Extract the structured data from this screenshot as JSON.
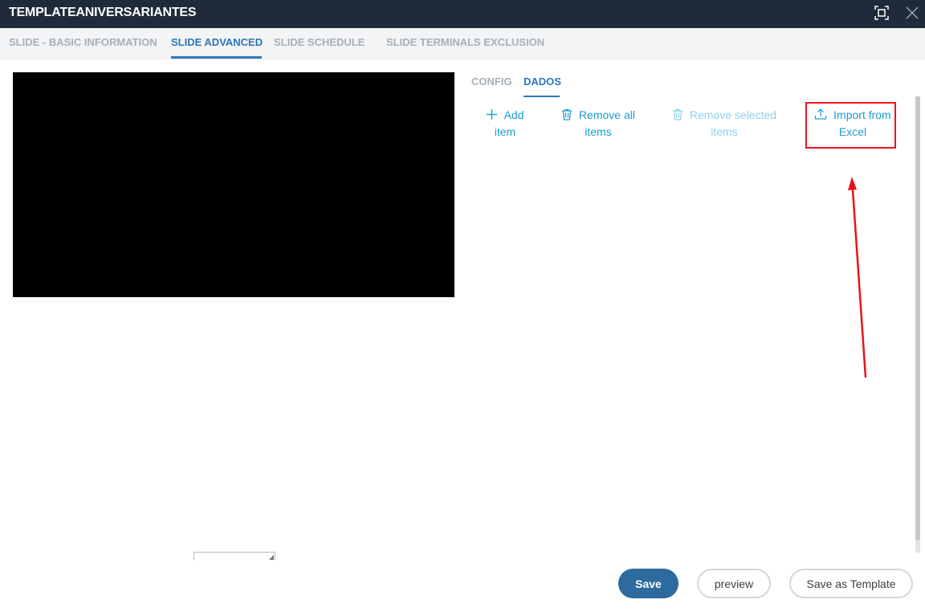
{
  "window": {
    "title": "TEMPLATEANIVERSARIANTES",
    "maximize_icon": "maximize-icon",
    "close_icon": "close-icon"
  },
  "tabs": [
    {
      "label": "SLIDE - BASIC INFORMATION",
      "active": false
    },
    {
      "label": "SLIDE ADVANCED",
      "active": true
    },
    {
      "label": "SLIDE SCHEDULE",
      "active": false
    },
    {
      "label": "SLIDE TERMINALS EXCLUSION",
      "active": false
    }
  ],
  "subtabs": [
    {
      "label": "CONFIG",
      "active": false
    },
    {
      "label": "DADOS",
      "active": true
    }
  ],
  "actions": {
    "add": {
      "line1": "Add",
      "line2": "item",
      "icon": "plus-icon"
    },
    "remove_all": {
      "line1": "Remove all",
      "line2": "items",
      "icon": "trash-icon"
    },
    "remove_selected": {
      "line1": "Remove selected",
      "line2": "items",
      "icon": "trash-icon",
      "disabled": true
    },
    "import": {
      "line1": "Import from",
      "line2": "Excel",
      "icon": "upload-icon"
    }
  },
  "footer": {
    "save_label": "Save",
    "preview_label": "preview",
    "save_template_label": "Save as Template"
  },
  "colors": {
    "titlebar": "#1f2b3a",
    "accent": "#2e76b8",
    "action": "#1a9ccf",
    "annotation": "#e8141c",
    "primary_button": "#2d6a9e"
  }
}
